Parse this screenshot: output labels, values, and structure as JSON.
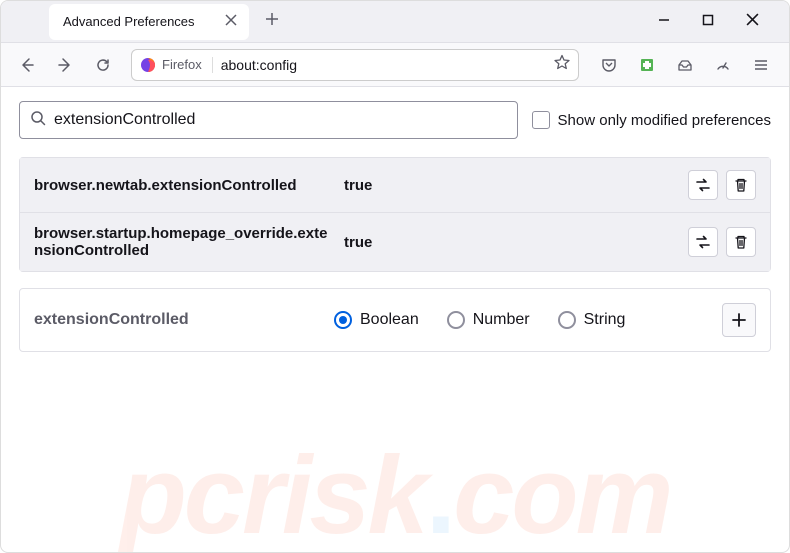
{
  "window": {
    "tab_title": "Advanced Preferences"
  },
  "toolbar": {
    "identity_label": "Firefox",
    "url": "about:config"
  },
  "search": {
    "value": "extensionControlled",
    "show_modified_label": "Show only modified preferences"
  },
  "prefs": [
    {
      "name": "browser.newtab.extensionControlled",
      "value": "true"
    },
    {
      "name": "browser.startup.homepage_override.extensionControlled",
      "value": "true"
    }
  ],
  "new_pref": {
    "name": "extensionControlled",
    "types": [
      "Boolean",
      "Number",
      "String"
    ],
    "selected": "Boolean"
  },
  "watermark": {
    "text_top": "pcrisk",
    "text_dot": ".",
    "text_bottom": "com"
  }
}
